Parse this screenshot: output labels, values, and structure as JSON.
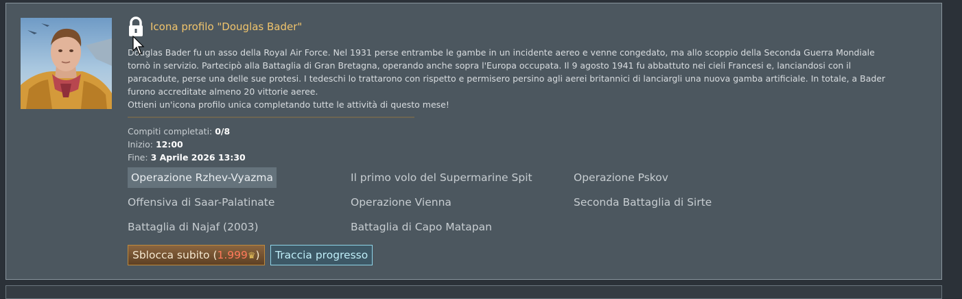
{
  "profile": {
    "title": "Icona profilo \"Douglas Bader\"",
    "description_lines": [
      "Douglas Bader fu un asso della Royal Air Force. Nel 1931 perse entrambe le gambe in un incidente aereo e venne congedato, ma allo scoppio della Seconda Guerra Mondiale",
      "tornò in servizio. Partecipò alla Battaglia di Gran Bretagna, operando anche sopra l'Europa occupata. Il 9 agosto 1941 fu abbattuto nei cieli Francesi e, lanciandosi con il",
      "paracadute, perse una delle sue protesi. I tedeschi lo trattarono con rispetto e permisero persino agli aerei britannici di lanciargli una nuova gamba artificiale. In totale, a Bader",
      "furono accreditate almeno 20 vittorie aeree.",
      "Ottieni un'icona profilo unica completando tutte le attività di questo mese!"
    ]
  },
  "stats": {
    "tasks_label": "Compiti completati:",
    "tasks_value": "0/8",
    "start_label": "Inizio:",
    "start_value": "12:00",
    "end_label": "Fine:",
    "end_value": "3 Aprile 2026 13:30"
  },
  "operations": [
    "Operazione Rzhev-Vyazma",
    "Il primo volo del Supermarine Spit",
    "Operazione Pskov",
    "Offensiva di Saar-Palatinate",
    "Operazione Vienna",
    "Seconda Battaglia di Sirte",
    "Battaglia di Najaf (2003)",
    "Battaglia di Capo Matapan"
  ],
  "buttons": {
    "unlock_label": "Sblocca subito (",
    "unlock_price": "1.999",
    "unlock_close": ")",
    "track_label": "Traccia progresso"
  },
  "icons": {
    "lock": "lock-icon",
    "currency": "golden-eagle-icon",
    "cursor": "mouse-cursor-icon"
  },
  "colors": {
    "title": "#f0c46c",
    "price": "#ff7a5a",
    "panel": "#4c575f"
  }
}
